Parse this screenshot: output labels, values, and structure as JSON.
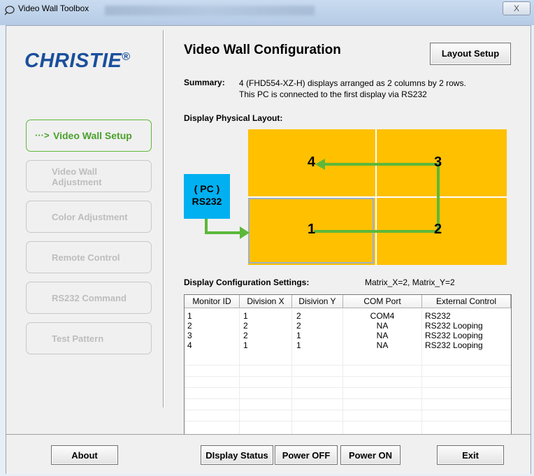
{
  "window": {
    "title": "Video Wall Toolbox",
    "close_glyph": "X"
  },
  "brand": {
    "logo": "CHRISTIE",
    "registered": "®"
  },
  "nav": {
    "items": [
      {
        "label": "Video Wall Setup",
        "arrow": "···>",
        "active": true
      },
      {
        "label": "Video Wall Adjustment",
        "line1": "Video Wall",
        "line2": "Adjustment",
        "active": false
      },
      {
        "label": "Color Adjustment",
        "active": false
      },
      {
        "label": "Remote Control",
        "active": false
      },
      {
        "label": "RS232 Command",
        "active": false
      },
      {
        "label": "Test Pattern",
        "active": false
      }
    ]
  },
  "main": {
    "title": "Video Wall Configuration",
    "layout_setup_label": "Layout Setup",
    "summary_label": "Summary:",
    "summary_line1": "4 (FHD554-XZ-H) displays arranged as 2 columns by 2 rows.",
    "summary_line2": "This PC is connected to the first display via RS232",
    "physical_layout_label": "Display Physical Layout:",
    "pc_label": "( PC )",
    "pc_port": "RS232",
    "display_numbers": [
      "4",
      "3",
      "1",
      "2"
    ],
    "config_label": "Display Configuration Settings:",
    "matrix_text": "Matrix_X=2, Matrix_Y=2"
  },
  "table": {
    "columns": [
      "Monitor ID",
      "Division X",
      "Disivion Y",
      "COM Port",
      "External Control"
    ],
    "rows": [
      [
        "1",
        "1",
        "2",
        "COM4",
        "RS232"
      ],
      [
        "2",
        "2",
        "2",
        "NA",
        "RS232 Looping"
      ],
      [
        "3",
        "2",
        "1",
        "NA",
        "RS232 Looping"
      ],
      [
        "4",
        "1",
        "1",
        "NA",
        "RS232 Looping"
      ]
    ]
  },
  "footer": {
    "about": "About",
    "display_status": "DIsplay Status",
    "power_off": "Power OFF",
    "power_on": "Power ON",
    "exit": "Exit"
  },
  "colors": {
    "accent_green": "#5cb83a",
    "display_fill": "#ffc000",
    "pc_box": "#00b0f0",
    "logo_blue": "#1a4f9c"
  }
}
